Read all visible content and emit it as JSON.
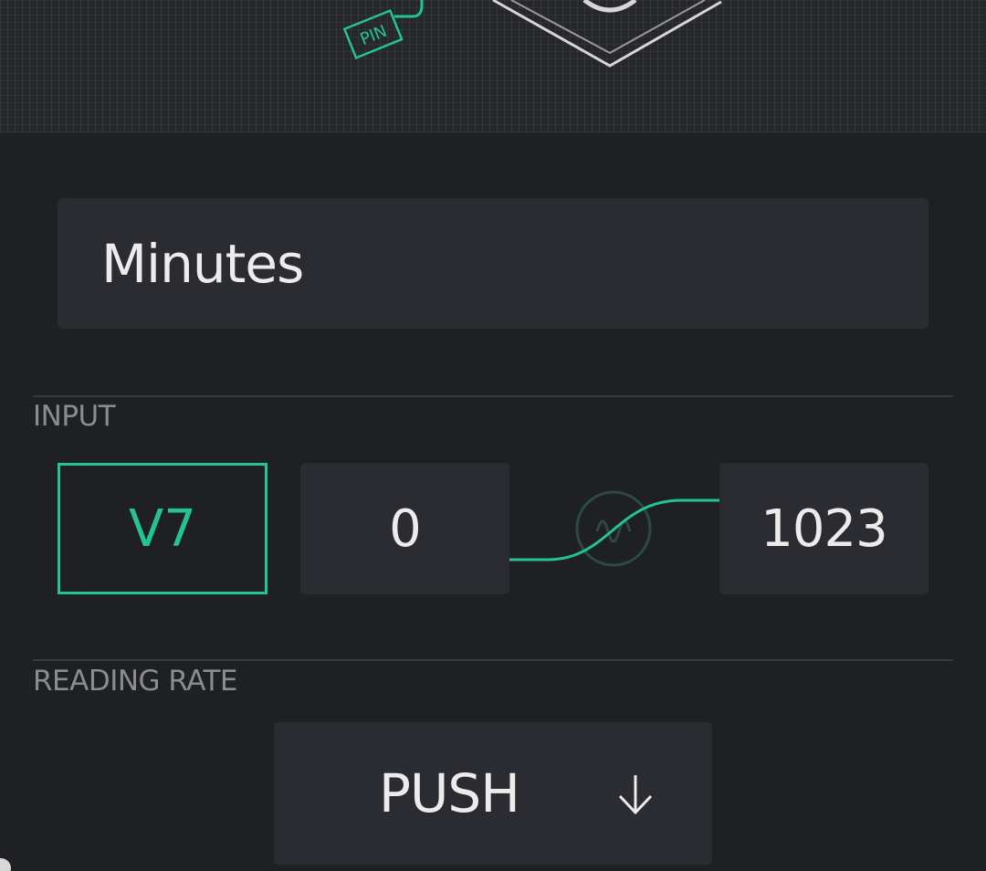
{
  "header": {
    "pin_tag": "PIN"
  },
  "name_field": {
    "value": "Minutes"
  },
  "input_section": {
    "label": "INPUT",
    "pin": "V7",
    "min_value": "0",
    "max_value": "1023"
  },
  "reading_rate_section": {
    "label": "READING RATE",
    "selected": "PUSH"
  },
  "colors": {
    "accent": "#23c48e",
    "background": "#1f2024",
    "field": "#2b2c31"
  }
}
